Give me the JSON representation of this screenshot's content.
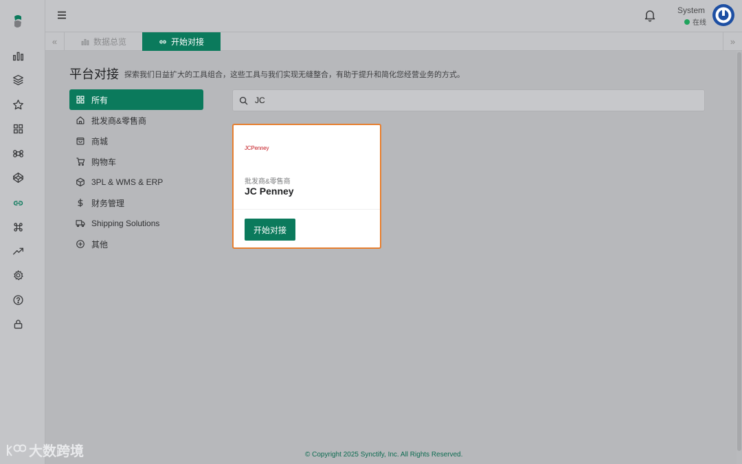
{
  "topbar": {
    "user_name": "System",
    "user_status": "在线"
  },
  "tabs": [
    {
      "label": "数据总览"
    },
    {
      "label": "开始对接"
    }
  ],
  "page": {
    "title": "平台对接",
    "description": "探索我们日益扩大的工具组合，这些工具与我们实现无缝整合，有助于提升和简化您经营业务的方式。"
  },
  "categories": [
    {
      "label": "所有",
      "icon": "grid-icon"
    },
    {
      "label": "批发商&零售商",
      "icon": "store-icon"
    },
    {
      "label": "商城",
      "icon": "shopping-bag-icon"
    },
    {
      "label": "购物车",
      "icon": "cart-icon"
    },
    {
      "label": "3PL & WMS & ERP",
      "icon": "box-icon"
    },
    {
      "label": "财务管理",
      "icon": "dollar-icon"
    },
    {
      "label": "Shipping Solutions",
      "icon": "truck-icon"
    },
    {
      "label": "其他",
      "icon": "plus-circle-icon"
    }
  ],
  "search": {
    "value": "JC"
  },
  "results": [
    {
      "logo_text": "JCPenney",
      "category": "批发商&零售商",
      "name": "JC Penney",
      "action_label": "开始对接"
    }
  ],
  "footer": {
    "text": "© Copyright 2025 Synctify, Inc. All Rights Reserved."
  },
  "watermark": {
    "text": "大数跨境"
  },
  "colors": {
    "accent": "#0b7a5c",
    "card_highlight": "#e67e2e",
    "brand_logo": "#c3151d",
    "status_online": "#1fa35c",
    "avatar": "#1d4fa3"
  }
}
